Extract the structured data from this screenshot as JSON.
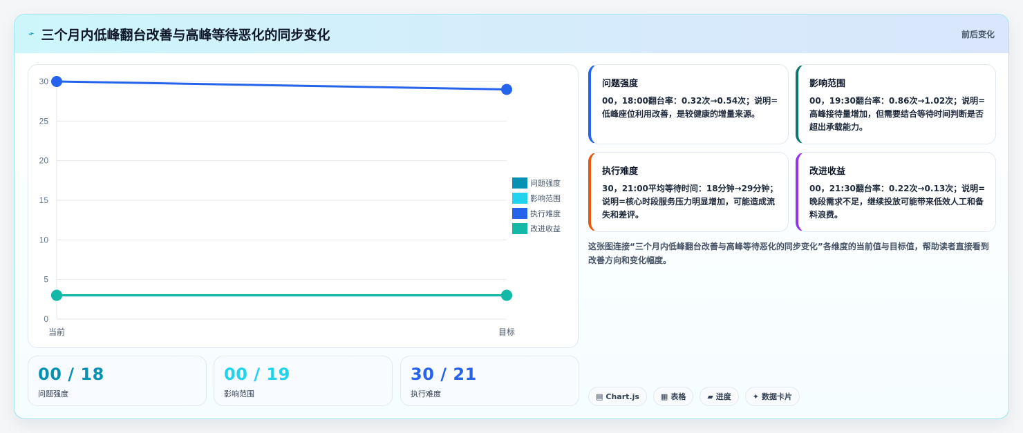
{
  "header": {
    "icon": "spark-icon",
    "title": "三个月内低峰翻台改善与高峰等待恶化的同步变化",
    "tag": "前后变化"
  },
  "chart_data": {
    "type": "line",
    "categories": [
      "当前",
      "目标"
    ],
    "ylim": [
      0,
      30
    ],
    "yticks": [
      0,
      5,
      10,
      15,
      20,
      25,
      30
    ],
    "legend": "right",
    "series": [
      {
        "name": "问题强度",
        "values": [
          3,
          3
        ],
        "color": "#0891b2"
      },
      {
        "name": "影响范围",
        "values": [
          3,
          3
        ],
        "color": "#22d3ee"
      },
      {
        "name": "执行难度",
        "values": [
          30,
          29
        ],
        "color": "#2563eb"
      },
      {
        "name": "改进收益",
        "values": [
          3,
          3
        ],
        "color": "#14b8a6"
      }
    ]
  },
  "stats": [
    {
      "value": "00 / 18",
      "label": "问题强度",
      "color": "#0891b2"
    },
    {
      "value": "00 / 19",
      "label": "影响范围",
      "color": "#22d3ee"
    },
    {
      "value": "30 / 21",
      "label": "执行难度",
      "color": "#2563eb"
    }
  ],
  "cards": [
    {
      "title": "问题强度",
      "text": "00，18:00翻台率：0.32次→0.54次；说明=低峰座位利用改善，是较健康的增量来源。",
      "color": "#2563eb"
    },
    {
      "title": "影响范围",
      "text": "00，19:30翻台率：0.86次→1.02次；说明=高峰接待量增加，但需要结合等待时间判断是否超出承载能力。",
      "color": "#0f766e"
    },
    {
      "title": "执行难度",
      "text": "30，21:00平均等待时间：18分钟→29分钟；说明=核心时段服务压力明显增加，可能造成流失和差评。",
      "color": "#ea580c"
    },
    {
      "title": "改进收益",
      "text": "00，21:30翻台率：0.22次→0.13次；说明=晚段需求不足，继续投放可能带来低效人工和备料浪费。",
      "color": "#9333ea"
    }
  ],
  "description": "这张图连接“三个月内低峰翻台改善与高峰等待恶化的同步变化”各维度的当前值与目标值，帮助读者直接看到改善方向和变化幅度。",
  "chips": [
    {
      "icon": "chart-icon",
      "glyph": "▤",
      "label": "Chart.js"
    },
    {
      "icon": "table-icon",
      "glyph": "▦",
      "label": "表格"
    },
    {
      "icon": "progress-icon",
      "glyph": "▰",
      "label": "进度"
    },
    {
      "icon": "sparkle-icon",
      "glyph": "✦",
      "label": "数据卡片"
    }
  ]
}
